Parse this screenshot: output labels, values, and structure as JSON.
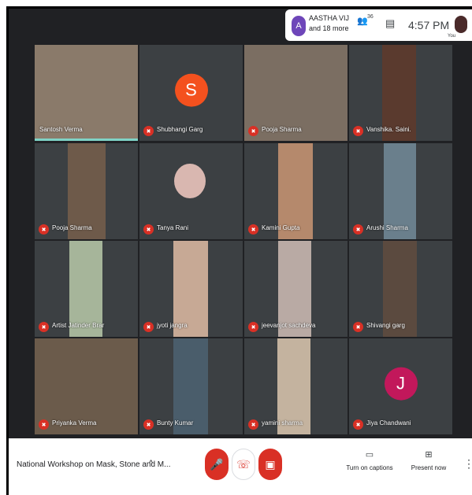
{
  "header": {
    "people_preview_initial": "A",
    "people_preview_name": "AASTHA VIJ",
    "people_preview_more": "and 18 more",
    "people_count": "36",
    "people_icon": "people-icon",
    "chat_icon": "chat-icon",
    "time": "4:57 PM",
    "self_label": "You"
  },
  "participants": [
    {
      "name": "Santosh Verma",
      "muted": false,
      "avatar_letter": "",
      "avatar_color": ""
    },
    {
      "name": "Shubhangi Garg",
      "muted": true,
      "avatar_letter": "S",
      "avatar_color": "#f4511e"
    },
    {
      "name": "Pooja Sharma",
      "muted": true,
      "avatar_letter": "",
      "avatar_color": ""
    },
    {
      "name": "Vanshika. Saini.",
      "muted": true,
      "avatar_letter": "",
      "avatar_color": ""
    },
    {
      "name": "Pooja Sharma",
      "muted": true,
      "avatar_letter": "",
      "avatar_color": ""
    },
    {
      "name": "Tanya Rani",
      "muted": true,
      "avatar_letter": "",
      "avatar_color": ""
    },
    {
      "name": "Kamini Gupta",
      "muted": true,
      "avatar_letter": "",
      "avatar_color": ""
    },
    {
      "name": "Arushi Sharma",
      "muted": true,
      "avatar_letter": "",
      "avatar_color": ""
    },
    {
      "name": "Artist Jatinder Brar",
      "muted": true,
      "avatar_letter": "",
      "avatar_color": ""
    },
    {
      "name": "jyoti jangra",
      "muted": true,
      "avatar_letter": "",
      "avatar_color": ""
    },
    {
      "name": "jeevanjot sachdeva",
      "muted": true,
      "avatar_letter": "",
      "avatar_color": ""
    },
    {
      "name": "Shivangi garg",
      "muted": true,
      "avatar_letter": "",
      "avatar_color": ""
    },
    {
      "name": "Priyanka Verma",
      "muted": true,
      "avatar_letter": "",
      "avatar_color": ""
    },
    {
      "name": "Bunty Kumar",
      "muted": true,
      "avatar_letter": "",
      "avatar_color": ""
    },
    {
      "name": "yamini sharma",
      "muted": true,
      "avatar_letter": "",
      "avatar_color": ""
    },
    {
      "name": "Jiya Chandwani",
      "muted": true,
      "avatar_letter": "J",
      "avatar_color": "#c2185b"
    }
  ],
  "bottom_bar": {
    "meeting_title": "National Workshop on Mask, Stone and M...",
    "caret": "^",
    "captions_label": "Turn on captions",
    "present_label": "Present now",
    "captions_icon": "cc-icon",
    "present_icon": "present-icon"
  },
  "colors": {
    "background": "#202124",
    "tile": "#3c4043",
    "muted_red": "#d93025",
    "active_speaker": "#7fd3c6"
  }
}
